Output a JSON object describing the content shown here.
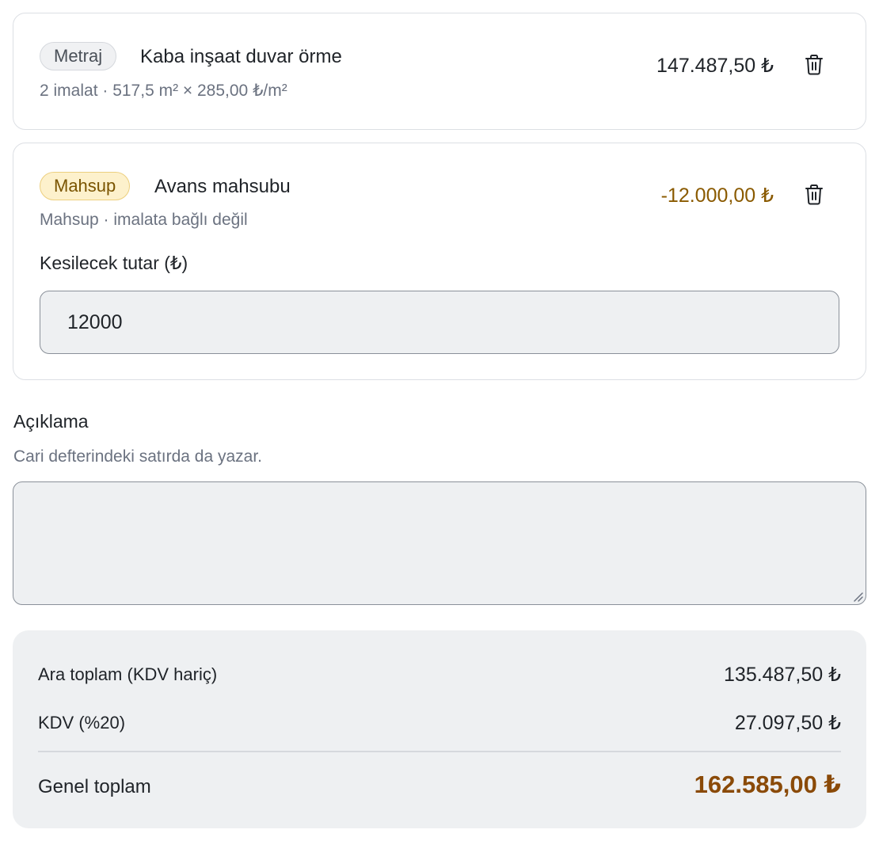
{
  "items": [
    {
      "badge": "Metraj",
      "title": "Kaba inşaat duvar örme",
      "subtitle": "2 imalat · 517,5 m² × 285,00 ₺/m²",
      "amount": "147.487,50 ₺"
    },
    {
      "badge": "Mahsup",
      "title": "Avans mahsubu",
      "subtitle": "Mahsup · imalata bağlı değil",
      "amount": "-12.000,00 ₺",
      "field_label": "Kesilecek tutar (₺)",
      "field_value": "12000"
    }
  ],
  "description": {
    "label": "Açıklama",
    "hint": "Cari defterindeki satırda da yazar.",
    "value": ""
  },
  "totals": {
    "subtotal_label": "Ara toplam (KDV hariç)",
    "subtotal_value": "135.487,50 ₺",
    "vat_label": "KDV (%20)",
    "vat_value": "27.097,50 ₺",
    "grand_label": "Genel toplam",
    "grand_value": "162.585,00 ₺"
  },
  "icons": {
    "delete": "trash-icon",
    "resize": "resize-grip-icon"
  },
  "colors": {
    "negative_amount": "#8a5a00",
    "grand_total": "#8a4a08",
    "badge_amber_bg": "#fdf1cc"
  }
}
